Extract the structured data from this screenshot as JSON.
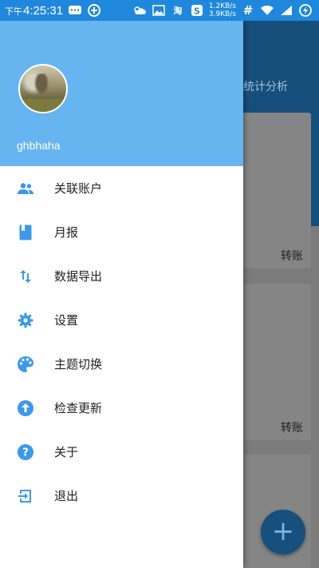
{
  "status_bar": {
    "time_prefix": "下午",
    "time": "4:25:31",
    "taobao_label": "淘",
    "speed_up": "1.2KB/s",
    "speed_down": "3.9KB/s",
    "network_symbol": "#",
    "accent_color": "#1f88dc"
  },
  "background_app": {
    "tab_label": "统计分析",
    "card1_label": "转账",
    "card2_label": "转账",
    "fab_label": "+"
  },
  "drawer": {
    "header_color": "#66b4f0",
    "username": "ghbhaha",
    "menu": [
      {
        "label": "关联账户",
        "icon": "people-icon"
      },
      {
        "label": "月报",
        "icon": "book-icon"
      },
      {
        "label": "数据导出",
        "icon": "swap-vertical-icon"
      },
      {
        "label": "设置",
        "icon": "gear-icon"
      },
      {
        "label": "主题切换",
        "icon": "palette-icon"
      },
      {
        "label": "检查更新",
        "icon": "arrow-up-circle-icon"
      },
      {
        "label": "关于",
        "icon": "help-circle-icon"
      },
      {
        "label": "退出",
        "icon": "exit-icon"
      }
    ],
    "icon_color": "#3d99e8"
  }
}
